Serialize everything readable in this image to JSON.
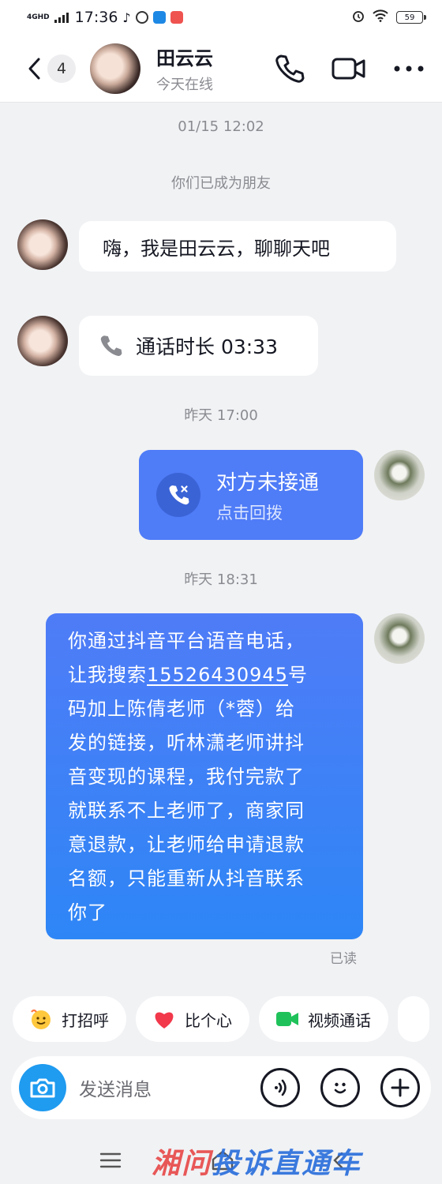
{
  "status_bar": {
    "network": "4GHD",
    "time": "17:36",
    "battery": "59"
  },
  "header": {
    "unread_count": "4",
    "name": "田云云",
    "presence": "今天在线"
  },
  "messages": {
    "ts1": "01/15 12:02",
    "system_note": "你们已成为朋友",
    "greeting": "嗨，我是田云云，聊聊天吧",
    "call_duration": "通话时长 03:33",
    "ts2": "昨天 17:00",
    "missed_title": "对方未接通",
    "missed_sub": "点击回拨",
    "ts3": "昨天 18:31",
    "long_lines": {
      "l1": "你通过抖音平台语音电话，",
      "l2a": "让我搜索",
      "l2b": "15526430945",
      "l2c": "号",
      "l3": "码加上陈倩老师（*蓉）给",
      "l4": "发的链接，听林潇老师讲抖",
      "l5": "音变现的课程，我付完款了",
      "l6": "就联系不上老师了，商家同",
      "l7": "意退款，让老师给申请退款",
      "l8": "名额，只能重新从抖音联系",
      "l9": "你了"
    },
    "read_receipt": "已读"
  },
  "quick_actions": {
    "greet": "打招呼",
    "heart": "比个心",
    "video": "视频通话"
  },
  "input": {
    "placeholder": "发送消息"
  },
  "watermark": {
    "part1": "湘问",
    "part2": "投诉直通车"
  },
  "colors": {
    "bubble_blue": "#4f7cf7",
    "camera_blue": "#1f9bf0",
    "background": "#f1f2f4"
  }
}
